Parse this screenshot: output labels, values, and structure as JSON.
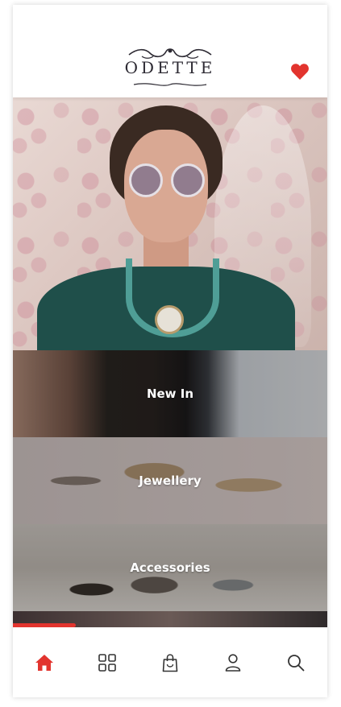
{
  "brand": {
    "logo_text": "ODETTE",
    "accent_color": "#e2342e"
  },
  "header": {
    "favorite_icon": "heart-icon"
  },
  "categories": [
    {
      "label": "New In"
    },
    {
      "label": "Jewellery"
    },
    {
      "label": "Accessories"
    }
  ],
  "carousel": {
    "progress": 0.2
  },
  "tabbar": {
    "items": [
      {
        "icon": "home-icon",
        "active": true
      },
      {
        "icon": "grid-icon",
        "active": false
      },
      {
        "icon": "shopping-bag-icon",
        "active": false
      },
      {
        "icon": "user-icon",
        "active": false
      },
      {
        "icon": "search-icon",
        "active": false
      }
    ]
  }
}
